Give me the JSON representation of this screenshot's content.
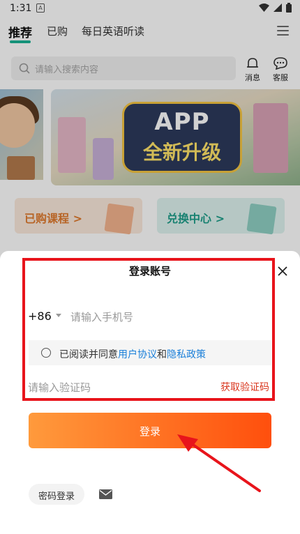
{
  "status_bar": {
    "time": "1:31",
    "notif_glyph": "A",
    "icons": [
      "wifi-icon",
      "signal-icon",
      "battery-icon"
    ]
  },
  "tabs": [
    {
      "label": "推荐",
      "active": true
    },
    {
      "label": "已购",
      "active": false
    },
    {
      "label": "每日英语听读",
      "active": false
    }
  ],
  "search": {
    "placeholder": "请输入搜索内容"
  },
  "header_buttons": {
    "message": "消息",
    "service": "客服"
  },
  "banner": {
    "line1": "APP",
    "line2": "全新升级"
  },
  "cards": [
    {
      "label": "已购课程 >",
      "color": "#e07a2e"
    },
    {
      "label": "兑换中心 >",
      "color": "#1e9e8a"
    }
  ],
  "login": {
    "title": "登录账号",
    "country_code": "+86",
    "phone_placeholder": "请输入手机号",
    "agree_prefix": "已阅读并同意",
    "user_agreement": "用户协议",
    "and": "和",
    "privacy_policy": "隐私政策",
    "code_placeholder": "请输入验证码",
    "get_code": "获取验证码",
    "submit": "登录",
    "password_login": "密码登录"
  },
  "colors": {
    "accent": "#1ab394",
    "highlight_box": "#e8141b",
    "button_start": "#ff9a3c",
    "button_end": "#ff4f0d",
    "link": "#1a7fd9"
  }
}
